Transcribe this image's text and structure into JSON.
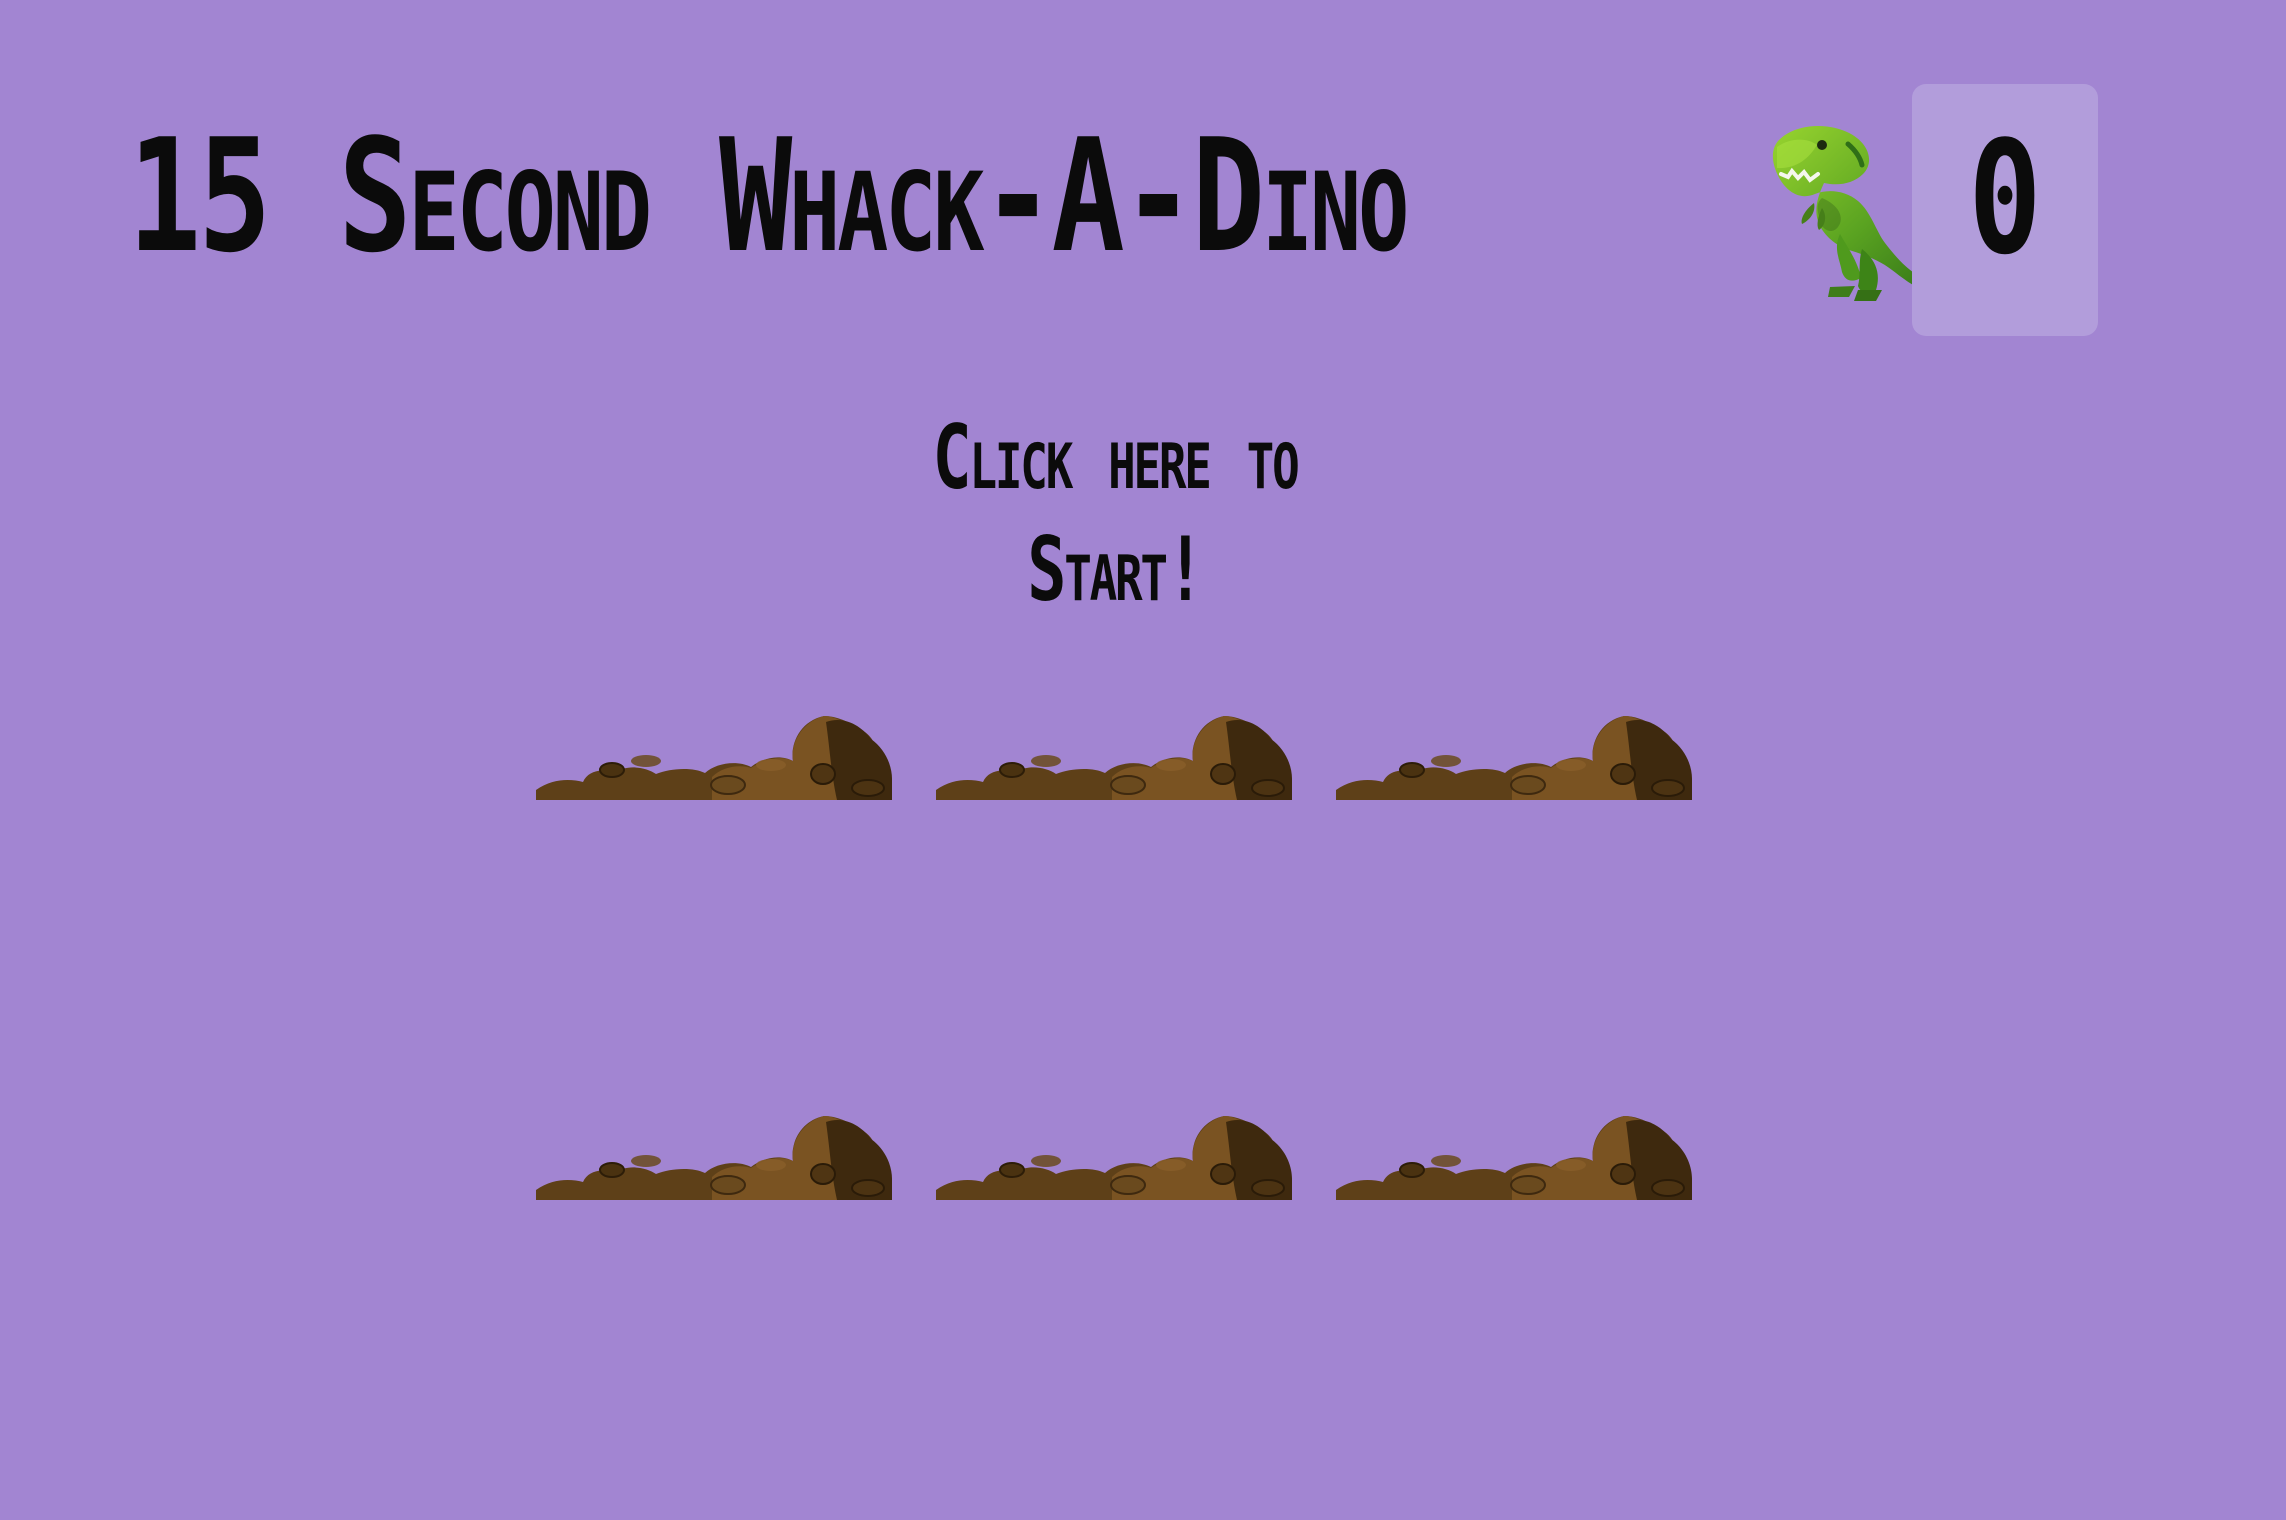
{
  "header": {
    "title": "15 Second Whack-A-Dino",
    "emoji_icon": "t-rex-icon",
    "exclamation": "!",
    "score": "0"
  },
  "start": {
    "label": "Click here to Start!"
  },
  "holes": [
    {
      "id": "hole-1"
    },
    {
      "id": "hole-2"
    },
    {
      "id": "hole-3"
    },
    {
      "id": "hole-4"
    },
    {
      "id": "hole-5"
    },
    {
      "id": "hole-6"
    }
  ],
  "colors": {
    "background": "#a285d2",
    "score_box": "#b29ddb",
    "dirt_light": "#7b5422",
    "dirt_dark": "#3f2a0d",
    "dirt_mid": "#5d3f17"
  }
}
